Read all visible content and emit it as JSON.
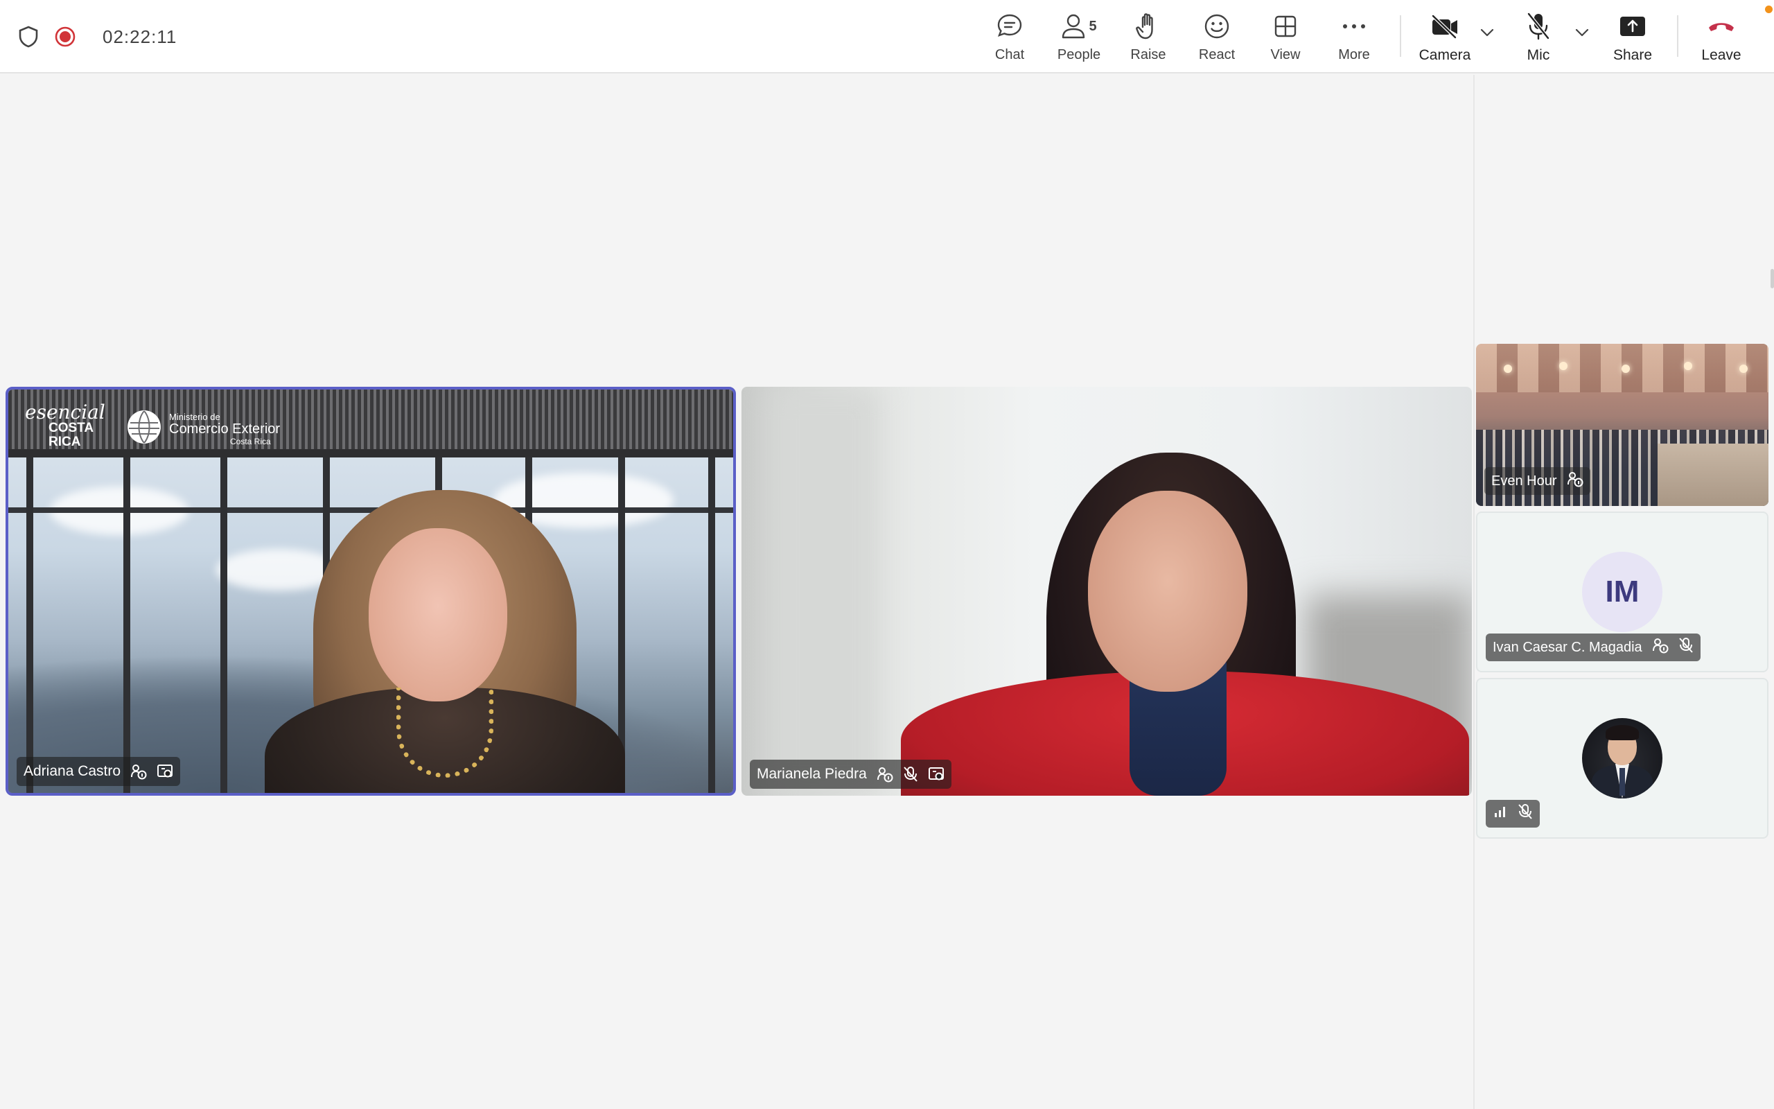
{
  "meeting": {
    "timer": "02:22:11"
  },
  "toolbar": {
    "chat_label": "Chat",
    "people_label": "People",
    "people_count": "5",
    "raise_label": "Raise",
    "react_label": "React",
    "view_label": "View",
    "more_label": "More",
    "camera_label": "Camera",
    "mic_label": "Mic",
    "share_label": "Share",
    "leave_label": "Leave"
  },
  "participants": {
    "main": [
      {
        "name": "Adriana Castro",
        "active_speaker": true
      },
      {
        "name": "Marianela Piedra",
        "muted": true
      }
    ],
    "side": [
      {
        "name": "Even Hour"
      },
      {
        "name": "Ivan Caesar C. Magadia",
        "initials": "IM",
        "muted": true
      },
      {
        "name": "",
        "muted": true
      }
    ]
  },
  "virtual_background": {
    "brand_line1": "esencial",
    "brand_line2": "COSTA",
    "brand_line3": "RICA",
    "ministry_line1": "Ministerio de",
    "ministry_line2": "Comercio Exterior",
    "ministry_line3": "Costa Rica"
  },
  "colors": {
    "accent": "#5b5fc7",
    "leave": "#c4314b",
    "record": "#d13438",
    "notification": "#f2921b"
  },
  "icons": {
    "security": "shield-icon",
    "recording": "record-icon",
    "chat": "chat-bubble-icon",
    "people": "people-icon",
    "raise": "hand-icon",
    "react": "smiley-icon",
    "view": "grid-icon",
    "more": "ellipsis-icon",
    "camera": "camera-off-icon",
    "mic": "mic-off-icon",
    "share": "share-tray-icon",
    "leave": "phone-hangup-icon"
  }
}
